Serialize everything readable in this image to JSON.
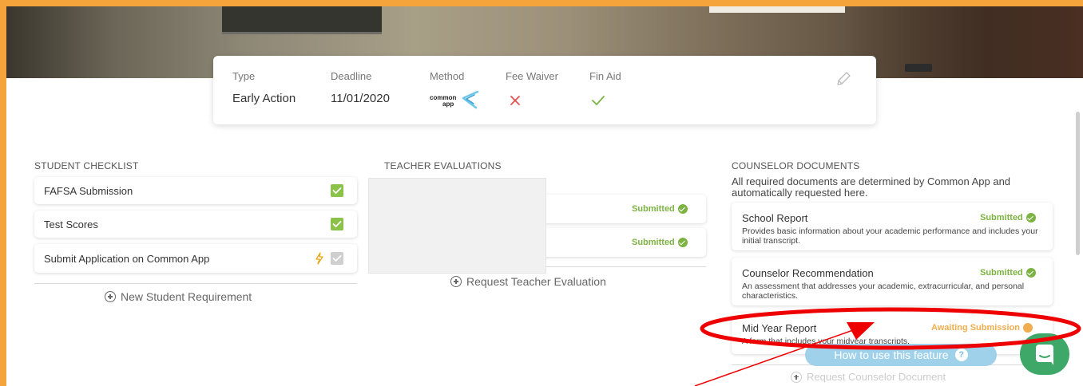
{
  "colors": {
    "accent_orange": "#f4a43b",
    "submitted_green": "#7cb342",
    "awaiting_orange": "#f0ad4e",
    "annotation_red": "#ee0000",
    "chat_green": "#3ea869",
    "howto_blue": "#9fd1ea"
  },
  "info": {
    "type_label": "Type",
    "type_value": "Early Action",
    "deadline_label": "Deadline",
    "deadline_value": "11/01/2020",
    "method_label": "Method",
    "method_logo_top": "common",
    "method_logo_bottom": "app",
    "fee_waiver_label": "Fee Waiver",
    "fee_waiver_icon": "x-icon",
    "fin_aid_label": "Fin Aid",
    "fin_aid_icon": "check-icon",
    "edit_icon": "pencil-icon"
  },
  "student_checklist": {
    "title": "STUDENT CHECKLIST",
    "items": [
      {
        "label": "FAFSA Submission",
        "status": "checked"
      },
      {
        "label": "Test Scores",
        "status": "checked"
      },
      {
        "label": "Submit Application on Common App",
        "status": "grey-checked",
        "extra_icon": "lightning-icon"
      }
    ],
    "add_label": "New Student Requirement"
  },
  "teacher_evaluations": {
    "title": "TEACHER EVALUATIONS",
    "items": [
      {
        "status": "Submitted"
      },
      {
        "status": "Submitted"
      }
    ],
    "add_label": "Request Teacher Evaluation"
  },
  "counselor_documents": {
    "title": "COUNSELOR DOCUMENTS",
    "description": "All required documents are determined by Common App and automatically requested here.",
    "items": [
      {
        "title": "School Report",
        "status": "Submitted",
        "desc": "Provides basic information about your academic performance and includes your initial transcript."
      },
      {
        "title": "Counselor Recommendation",
        "status": "Submitted",
        "desc": "An assessment that addresses your academic, extracurricular, and personal characteristics."
      },
      {
        "title": "Mid Year Report",
        "status": "Awaiting Submission",
        "desc": "A form that includes your midyear transcripts."
      }
    ],
    "add_label": "Request Counselor Document"
  },
  "howto": {
    "label": "How to use this feature",
    "icon": "question-icon"
  },
  "chat": {
    "icon": "chat-icon"
  }
}
